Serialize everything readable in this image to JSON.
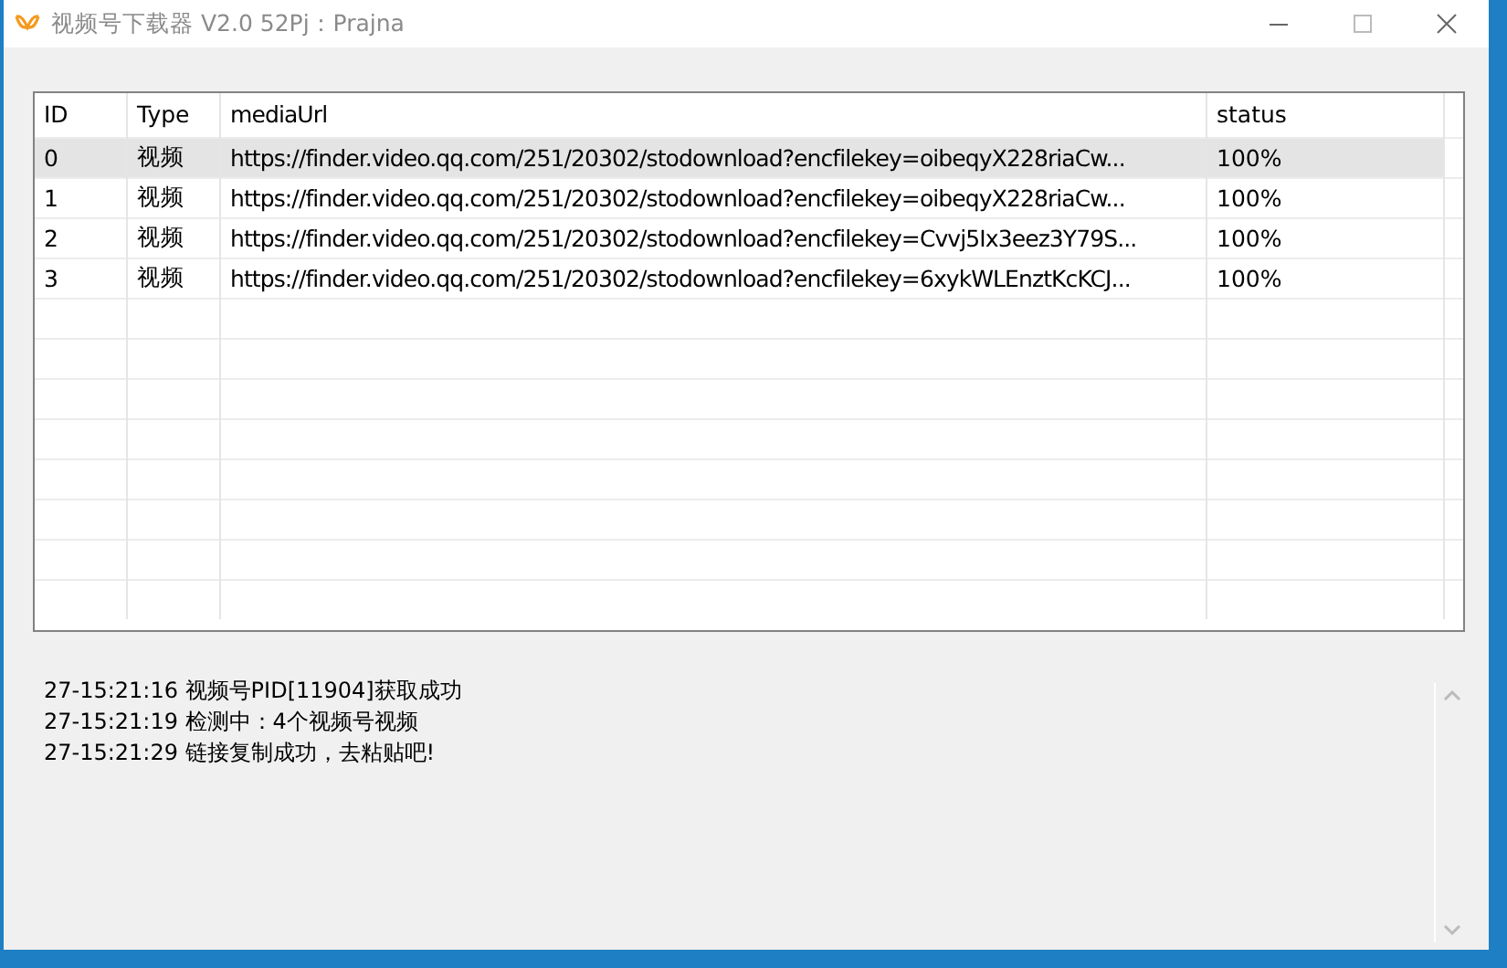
{
  "window": {
    "title": "视频号下载器 V2.0 52Pj：Prajna"
  },
  "table": {
    "columns": [
      "ID",
      "Type",
      "mediaUrl",
      "status"
    ],
    "rows": [
      {
        "cells": [
          "0",
          "视频",
          "https://finder.video.qq.com/251/20302/stodownload?encfilekey=oibeqyX228riaCw...",
          "100%"
        ],
        "selected": true
      },
      {
        "cells": [
          "1",
          "视频",
          "https://finder.video.qq.com/251/20302/stodownload?encfilekey=oibeqyX228riaCw...",
          "100%"
        ],
        "selected": false
      },
      {
        "cells": [
          "2",
          "视频",
          "https://finder.video.qq.com/251/20302/stodownload?encfilekey=Cvvj5Ix3eez3Y79S...",
          "100%"
        ],
        "selected": false
      },
      {
        "cells": [
          "3",
          "视频",
          "https://finder.video.qq.com/251/20302/stodownload?encfilekey=6xykWLEnztKcKCJ...",
          "100%"
        ],
        "selected": false
      }
    ]
  },
  "log": [
    "27-15:21:16 视频号PID[11904]获取成功",
    "27-15:21:19 检测中：4个视频号视频",
    "27-15:21:29 链接复制成功，去粘贴吧!"
  ]
}
